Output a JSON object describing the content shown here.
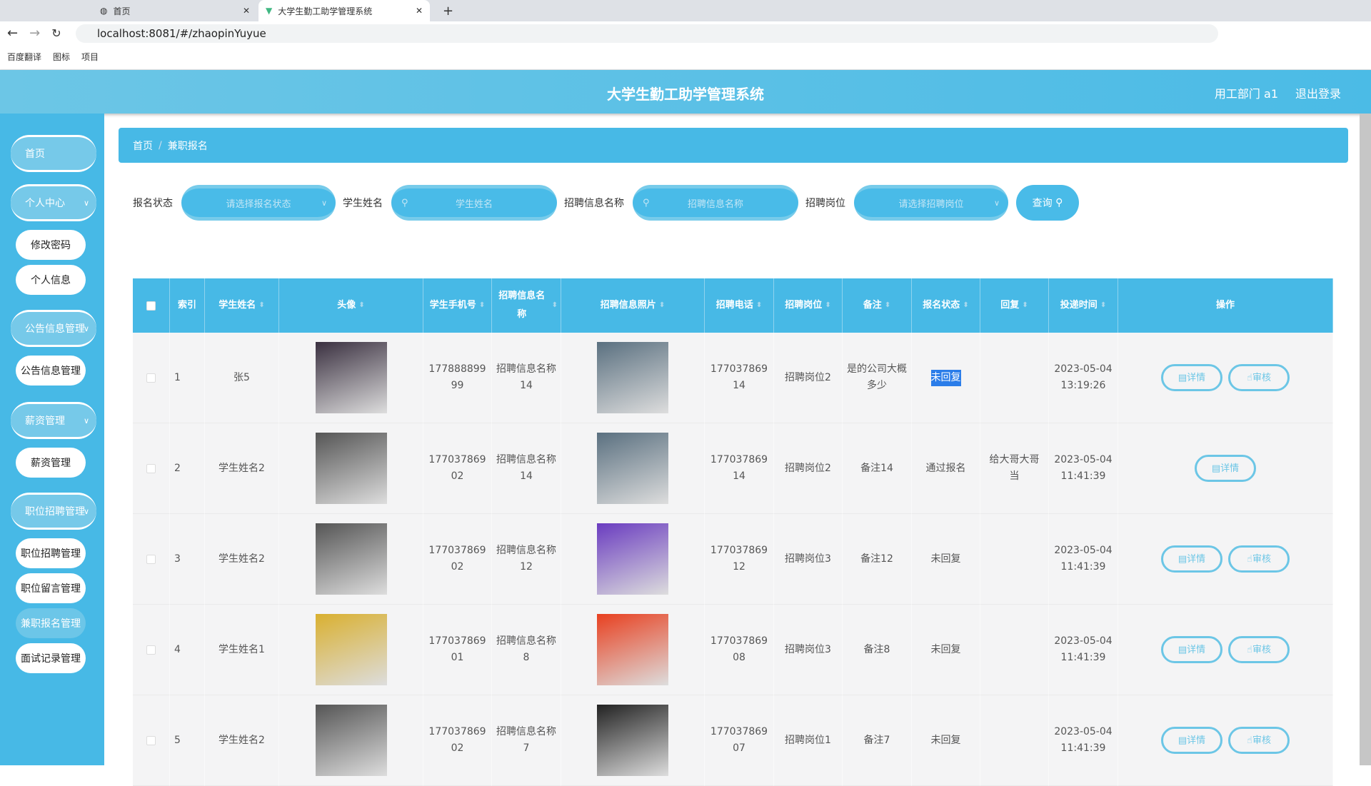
{
  "browser": {
    "tabs": [
      {
        "label": "首页"
      },
      {
        "label": "大学生勤工助学管理系统"
      }
    ],
    "url": "localhost:8081/#/zhaopinYuyue",
    "bookmarks": [
      "百度翻译",
      "图标",
      "项目"
    ]
  },
  "header": {
    "title": "大学生勤工助学管理系统",
    "user": "用工部门 a1",
    "logout": "退出登录"
  },
  "sidebar": [
    {
      "label": "首页",
      "type": "top"
    },
    {
      "label": "个人中心",
      "type": "top",
      "chevron": true
    },
    {
      "label": "修改密码",
      "type": "sub"
    },
    {
      "label": "个人信息",
      "type": "sub"
    },
    {
      "label": "公告信息管理",
      "type": "top",
      "chevron": true
    },
    {
      "label": "公告信息管理",
      "type": "sub"
    },
    {
      "label": "薪资管理",
      "type": "top",
      "chevron": true
    },
    {
      "label": "薪资管理",
      "type": "sub"
    },
    {
      "label": "职位招聘管理",
      "type": "top",
      "chevron": true
    },
    {
      "label": "职位招聘管理",
      "type": "sub"
    },
    {
      "label": "职位留言管理",
      "type": "sub"
    },
    {
      "label": "兼职报名管理",
      "type": "sub",
      "active": true
    },
    {
      "label": "面试记录管理",
      "type": "sub"
    }
  ],
  "breadcrumb": {
    "home": "首页",
    "sep": "/",
    "current": "兼职报名"
  },
  "filters": {
    "status_label": "报名状态",
    "status_placeholder": "请选择报名状态",
    "name_label": "学生姓名",
    "name_placeholder": "学生姓名",
    "info_label": "招聘信息名称",
    "info_placeholder": "招聘信息名称",
    "post_label": "招聘岗位",
    "post_placeholder": "请选择招聘岗位",
    "query": "查询"
  },
  "table": {
    "columns": [
      "",
      "索引",
      "学生姓名",
      "头像",
      "学生手机号",
      "招聘信息名称",
      "招聘信息照片",
      "招聘电话",
      "招聘岗位",
      "备注",
      "报名状态",
      "回复",
      "投递时间",
      "操作"
    ],
    "detail": "详情",
    "audit": "审核",
    "rows": [
      {
        "idx": "1",
        "name": "张5",
        "phone": "17788889999",
        "info": "招聘信息名称14",
        "tel": "17703786914",
        "post": "招聘岗位2",
        "note": "是的公司大概多少",
        "status": "未回复",
        "reply": "",
        "time": "2023-05-04 13:19:26",
        "audit": true,
        "avatar": "#3a3040",
        "pic": "#5a7080"
      },
      {
        "idx": "2",
        "name": "学生姓名2",
        "phone": "17703786902",
        "info": "招聘信息名称14",
        "tel": "17703786914",
        "post": "招聘岗位2",
        "note": "备注14",
        "status": "通过报名",
        "reply": "给大哥大哥当",
        "time": "2023-05-04 11:41:39",
        "audit": false,
        "avatar": "#555",
        "pic": "#5a7080"
      },
      {
        "idx": "3",
        "name": "学生姓名2",
        "phone": "17703786902",
        "info": "招聘信息名称12",
        "tel": "17703786912",
        "post": "招聘岗位3",
        "note": "备注12",
        "status": "未回复",
        "reply": "",
        "time": "2023-05-04 11:41:39",
        "audit": true,
        "avatar": "#555",
        "pic": "#6a3cc0"
      },
      {
        "idx": "4",
        "name": "学生姓名1",
        "phone": "17703786901",
        "info": "招聘信息名称8",
        "tel": "17703786908",
        "post": "招聘岗位3",
        "note": "备注8",
        "status": "未回复",
        "reply": "",
        "time": "2023-05-04 11:41:39",
        "audit": true,
        "avatar": "#d9b030",
        "pic": "#e84020"
      },
      {
        "idx": "5",
        "name": "学生姓名2",
        "phone": "17703786902",
        "info": "招聘信息名称7",
        "tel": "17703786907",
        "post": "招聘岗位1",
        "note": "备注7",
        "status": "未回复",
        "reply": "",
        "time": "2023-05-04 11:41:39",
        "audit": true,
        "avatar": "#555",
        "pic": "#222"
      }
    ]
  }
}
